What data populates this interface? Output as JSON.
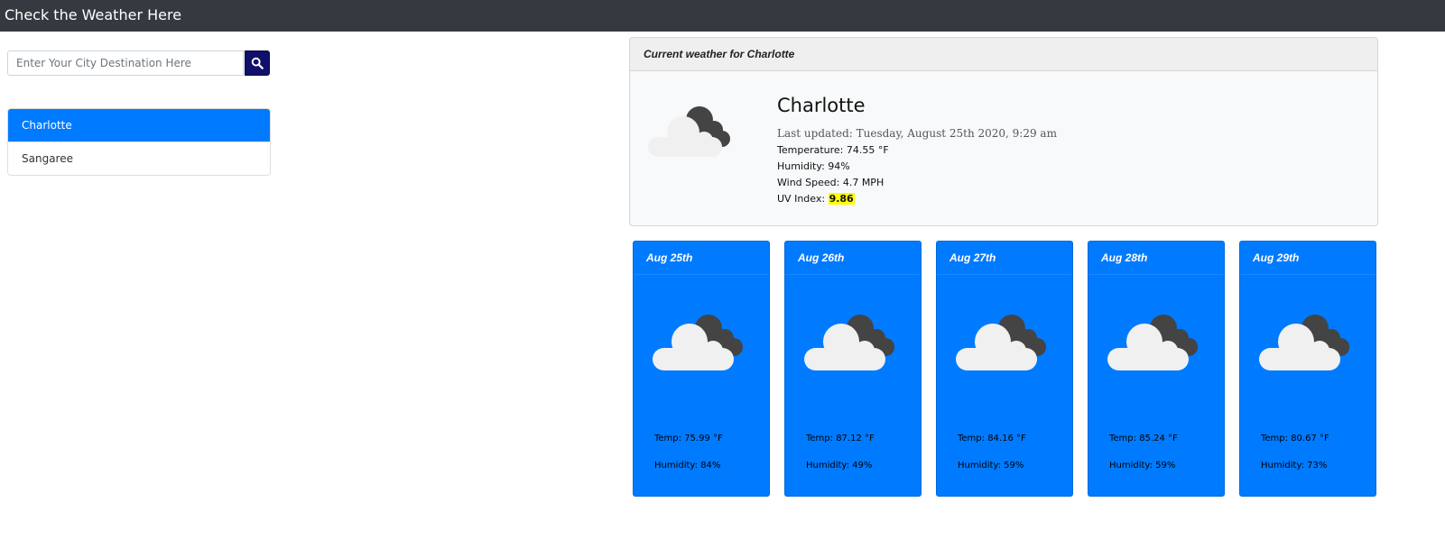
{
  "navbar": {
    "title": "Check the Weather Here"
  },
  "search": {
    "placeholder": "Enter Your City Destination Here",
    "button_icon": "search-icon"
  },
  "cities": [
    {
      "label": "Charlotte",
      "active": true
    },
    {
      "label": "Sangaree",
      "active": false
    }
  ],
  "current": {
    "header": "Current weather for Charlotte",
    "city": "Charlotte",
    "updated": "Last updated: Tuesday, August 25th 2020, 9:29 am",
    "temperature": "Temperature: 74.55 °F",
    "humidity": "Humidity: 94%",
    "wind": "Wind Speed: 4.7 MPH",
    "uv_label": "UV Index:",
    "uv_value": "9.86",
    "icon": "cloudy-icon"
  },
  "forecast": [
    {
      "date": "Aug 25th",
      "temp": "Temp: 75.99 °F",
      "humidity": "Humidity: 84%",
      "icon": "cloudy-icon"
    },
    {
      "date": "Aug 26th",
      "temp": "Temp: 87.12 °F",
      "humidity": "Humidity: 49%",
      "icon": "cloudy-icon"
    },
    {
      "date": "Aug 27th",
      "temp": "Temp: 84.16 °F",
      "humidity": "Humidity: 59%",
      "icon": "cloudy-icon"
    },
    {
      "date": "Aug 28th",
      "temp": "Temp: 85.24 °F",
      "humidity": "Humidity: 59%",
      "icon": "cloudy-icon"
    },
    {
      "date": "Aug 29th",
      "temp": "Temp: 80.67 °F",
      "humidity": "Humidity: 73%",
      "icon": "cloudy-icon"
    }
  ],
  "colors": {
    "navbar": "#343a40",
    "primary": "#007bff",
    "search_button": "#10106a",
    "uv_highlight": "#ffff00",
    "cloud_light": "#f0f0f0",
    "cloud_dark": "#444444"
  }
}
